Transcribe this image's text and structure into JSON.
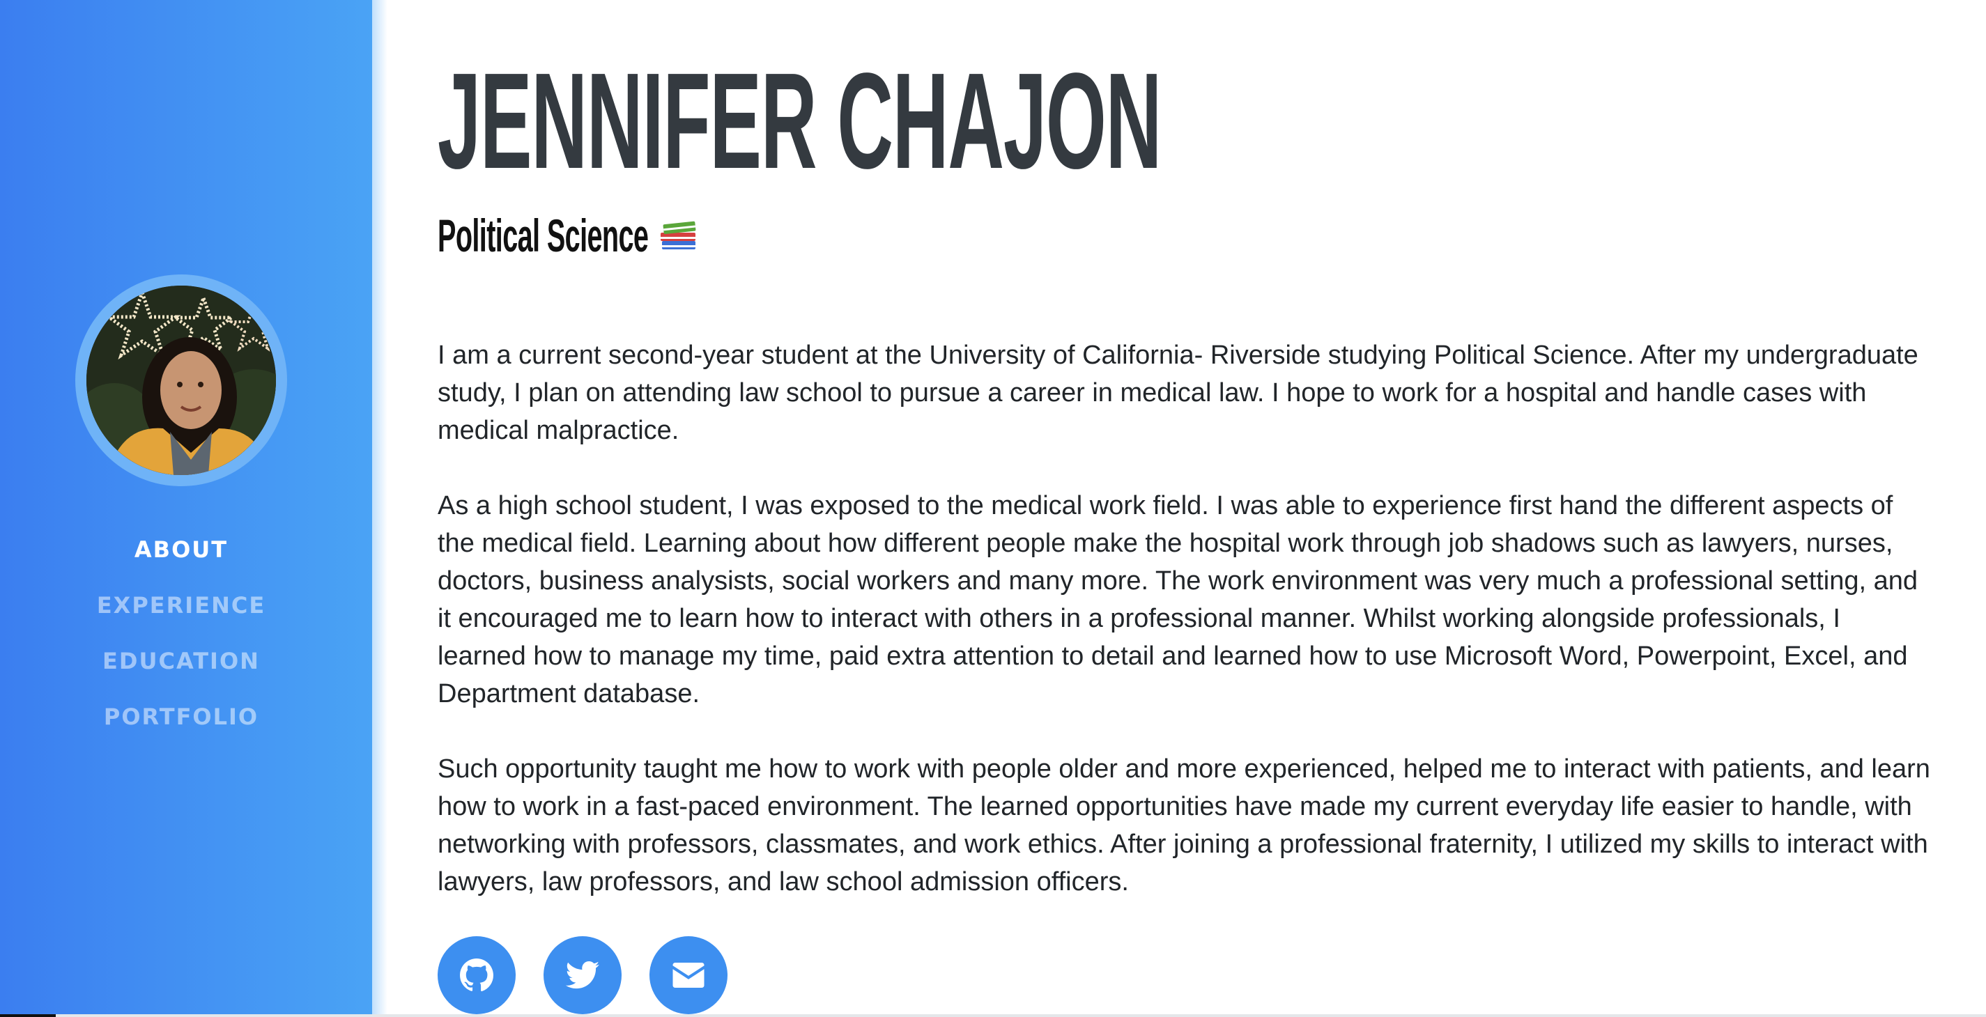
{
  "profile": {
    "name": "JENNIFER CHAJON",
    "subtitle": "Political Science"
  },
  "nav": {
    "items": [
      {
        "label": "ABOUT",
        "active": true
      },
      {
        "label": "EXPERIENCE",
        "active": false
      },
      {
        "label": "EDUCATION",
        "active": false
      },
      {
        "label": "PORTFOLIO",
        "active": false
      }
    ]
  },
  "about": {
    "paragraphs": [
      "I am a current second-year student at the University of California- Riverside studying Political Science. After my undergraduate study, I plan on attending law school to pursue a career in medical law. I hope to work for a hospital and handle cases with medical malpractice.",
      "As a high school student, I was exposed to the medical work field. I was able to experience first hand the different aspects of the medical field. Learning about how different people make the hospital work through job shadows such as lawyers, nurses, doctors, business analysists, social workers and many more. The work environment was very much a professional setting, and it encouraged me to learn how to interact with others in a professional manner. Whilst working alongside professionals, I learned how to manage my time, paid extra attention to detail and learned how to use Microsoft Word, Powerpoint, Excel, and Department database.",
      "Such opportunity taught me how to work with people older and more experienced, helped me to interact with patients, and learn how to work in a fast-paced environment. The learned opportunities have made my current everyday life easier to handle, with networking with professors, classmates, and work ethics. After joining a professional fraternity, I utilized my skills to interact with lawyers, law professors, and law school admission officers."
    ]
  },
  "social": {
    "links": [
      {
        "icon": "github-icon"
      },
      {
        "icon": "twitter-icon"
      },
      {
        "icon": "envelope-icon"
      }
    ]
  },
  "colors": {
    "sidebar_start": "#3b7ef0",
    "sidebar_end": "#4aa3f5",
    "heading": "#343a40",
    "text": "#212529",
    "social_button": "#3d8ff0"
  }
}
